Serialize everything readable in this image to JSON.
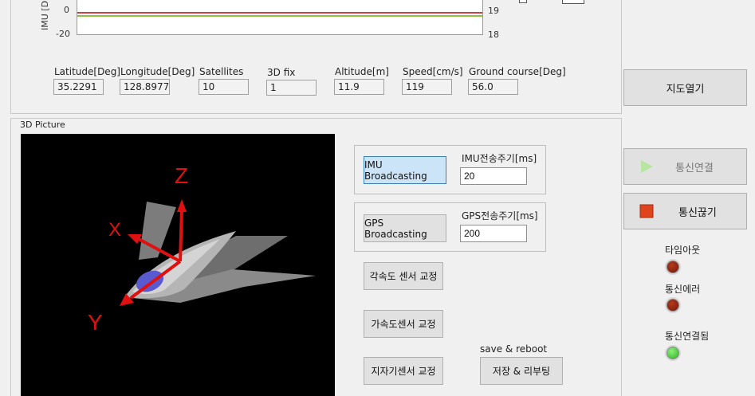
{
  "chart": {
    "y_axis_title": "IMU [D",
    "left_ticks": [
      "0",
      "-20"
    ],
    "right_ticks": [
      "19",
      "18"
    ],
    "trace_colors": [
      "#c00000",
      "#6aa800"
    ]
  },
  "gps": {
    "fields": [
      {
        "label": "Latitude[Deg]",
        "value": "35.2291"
      },
      {
        "label": "Longitude[Deg]",
        "value": "128.8977"
      },
      {
        "label": "Satellites",
        "value": "10"
      },
      {
        "label": "3D fix",
        "value": "1"
      },
      {
        "label": "Altitude[m]",
        "value": "11.9"
      },
      {
        "label": "Speed[cm/s]",
        "value": "119"
      },
      {
        "label": "Ground course[Deg]",
        "value": "56.0"
      }
    ]
  },
  "map_button": "지도열기",
  "picture": {
    "title": "3D Picture",
    "axes": {
      "z": "Z",
      "x": "X",
      "y": "Y"
    },
    "axis_color": "#e01010"
  },
  "imu": {
    "button": "IMU Broadcasting",
    "period_label": "IMU전송주기[ms]",
    "period_value": "20"
  },
  "gps_broadcast": {
    "button": "GPS Broadcasting",
    "period_label": "GPS전송주기[ms]",
    "period_value": "200"
  },
  "calibration": {
    "gyro": "각속도 센서 교정",
    "accel": "가속도센서 교정",
    "mag": "지자기센서 교정",
    "save_label": "save & reboot",
    "save_button": "저장 & 리부팅"
  },
  "comm": {
    "connect": "통신연결",
    "disconnect": "통신끊기",
    "connect_icon": "play-icon",
    "disconnect_icon": "stop-icon"
  },
  "indicators": [
    {
      "label": "타임아웃",
      "state": "off"
    },
    {
      "label": "통신에러",
      "state": "off"
    },
    {
      "label": "통신연결됨",
      "state": "on"
    }
  ]
}
